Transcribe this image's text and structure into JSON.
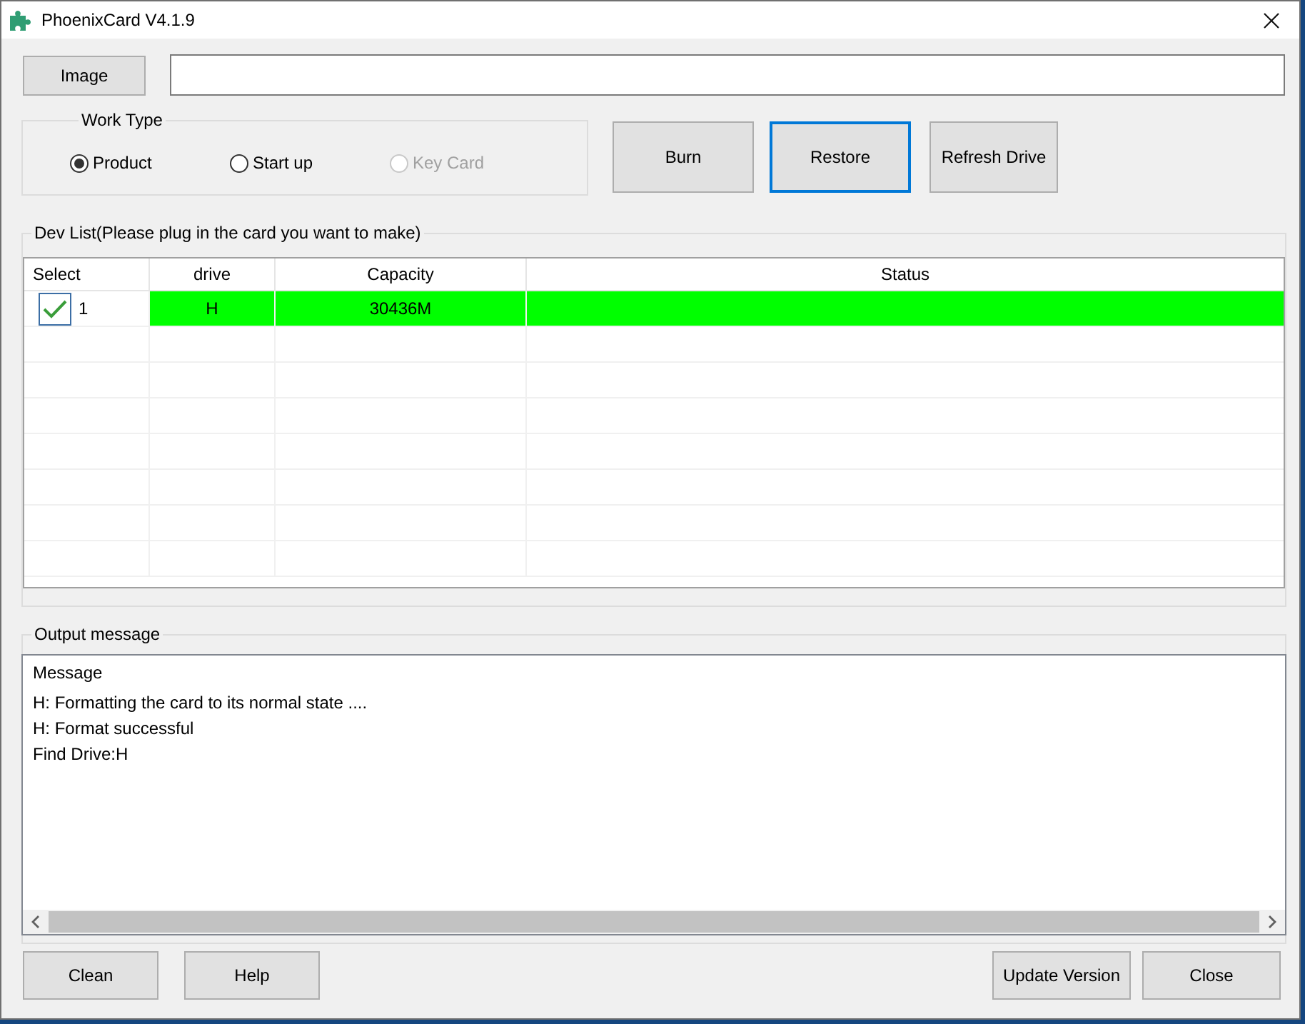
{
  "window": {
    "title": "PhoenixCard V4.1.9"
  },
  "image": {
    "button": "Image"
  },
  "work_type": {
    "legend": "Work Type",
    "options": [
      {
        "label": "Product",
        "selected": true,
        "disabled": false
      },
      {
        "label": "Start up",
        "selected": false,
        "disabled": false
      },
      {
        "label": "Key Card",
        "selected": false,
        "disabled": true
      }
    ]
  },
  "actions": [
    {
      "label": "Burn",
      "focused": false
    },
    {
      "label": "Restore",
      "focused": true
    },
    {
      "label": "Refresh Drive",
      "focused": false
    }
  ],
  "dev_list": {
    "legend": "Dev List(Please plug in the card you want to make)",
    "columns": [
      "Select",
      "drive",
      "Capacity",
      "Status"
    ],
    "rows": [
      {
        "checked": true,
        "number": "1",
        "drive": "H",
        "capacity": "30436M",
        "color": "#00ff00"
      }
    ]
  },
  "output": {
    "legend": "Output message",
    "lines": [
      "Message",
      "H: Formatting the card to its normal state ....",
      "H: Format successful",
      "Find Drive:H"
    ]
  },
  "footer": {
    "left": [
      "Clean",
      "Help"
    ],
    "right": [
      "Update Version",
      "Close"
    ]
  }
}
